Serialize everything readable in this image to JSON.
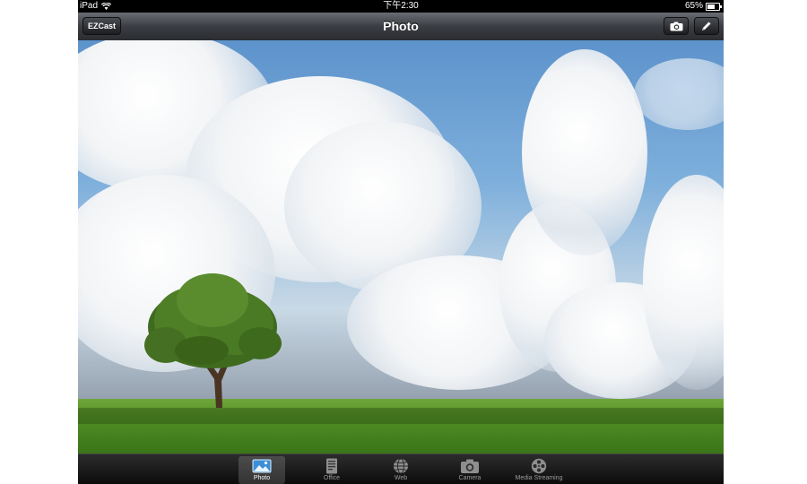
{
  "status_bar": {
    "device": "iPad",
    "time": "下午2:30",
    "battery": "65%",
    "battery_level": 0.65
  },
  "nav": {
    "title": "Photo",
    "left_button": "EZCast",
    "right_buttons": [
      "camera-icon",
      "pencil-icon"
    ]
  },
  "tabs": [
    {
      "label": "Photo",
      "icon": "photo-icon",
      "selected": true
    },
    {
      "label": "Office",
      "icon": "document-icon",
      "selected": false
    },
    {
      "label": "Web",
      "icon": "globe-icon",
      "selected": false
    },
    {
      "label": "Camera",
      "icon": "camera-icon",
      "selected": false
    },
    {
      "label": "Media Streaming",
      "icon": "film-reel-icon",
      "selected": false
    }
  ],
  "colors": {
    "selected_tab": "#ffffff",
    "unselected_tab": "#9a9a9a",
    "nav_bar": "#3a3d42"
  }
}
